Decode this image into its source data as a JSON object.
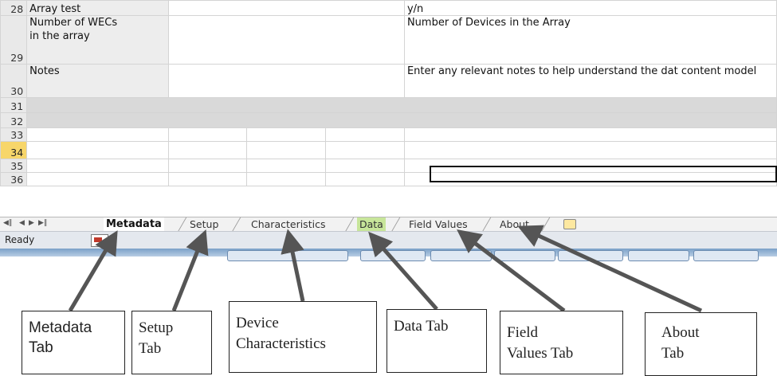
{
  "rows": [
    {
      "num": "28",
      "field": "Array test",
      "description": "y/n"
    },
    {
      "num": "29",
      "field": "Number of WECs in the array",
      "description": "Number of Devices in the Array"
    },
    {
      "num": "30",
      "field": "Notes",
      "description": "Enter any relevant notes to help understand the dat content model"
    },
    {
      "num": "31"
    },
    {
      "num": "32"
    },
    {
      "num": "33"
    },
    {
      "num": "34"
    },
    {
      "num": "35"
    },
    {
      "num": "36"
    }
  ],
  "sheet_tabs": [
    "Metadata",
    "Setup",
    "Characteristics",
    "Data",
    "Field Values",
    "About"
  ],
  "active_tab": "Metadata",
  "status": "Ready",
  "callouts": [
    {
      "line1": "Metadata",
      "line2": "Tab"
    },
    {
      "line1": "Setup",
      "line2": "Tab"
    },
    {
      "line1": "Device",
      "line2": "Characteristics"
    },
    {
      "line1": "Data Tab",
      "line2": ""
    },
    {
      "line1": "Field",
      "line2": "Values Tab"
    },
    {
      "line1": "About",
      "line2": "Tab"
    }
  ],
  "colors": {
    "data_tab": "#c7e59a",
    "selected_row": "#f7d66a",
    "arrow": "#555555"
  }
}
